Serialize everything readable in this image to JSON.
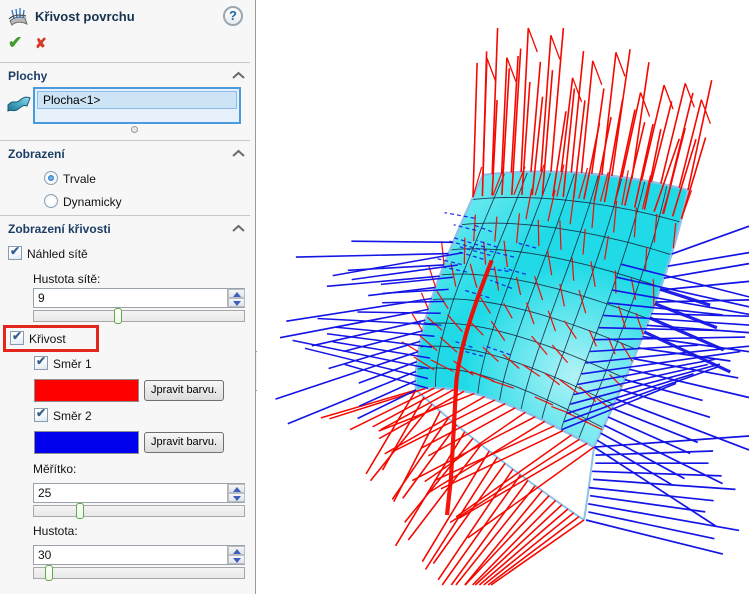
{
  "panel": {
    "title": "Křivost povrchu",
    "help_glyph": "?",
    "ok_glyph": "✔",
    "cancel_glyph": "✘",
    "check_glyph": "✔",
    "sections": {
      "plochy": {
        "label": "Plochy",
        "items": [
          "Plocha<1>"
        ]
      },
      "zobrazeni": {
        "label": "Zobrazení",
        "options": [
          {
            "label": "Trvale",
            "selected": true
          },
          {
            "label": "Dynamicky",
            "selected": false
          }
        ]
      },
      "zobrazeni_krivosti": {
        "label": "Zobrazení křivosti",
        "nahled_site": {
          "label": "Náhled sítě",
          "checked": true
        },
        "hustota_site": {
          "label": "Hustota sítě:",
          "value": "9",
          "slider_pos": 0.4
        },
        "krivost": {
          "label": "Křivost",
          "checked": true,
          "highlight_color": "#e3261d"
        },
        "smer1": {
          "label": "Směr 1",
          "checked": true,
          "color": "#ff0000",
          "button": "Jpravit barvu."
        },
        "smer2": {
          "label": "Směr 2",
          "checked": true,
          "color": "#0000ee",
          "button": "Jpravit barvu."
        },
        "meritko": {
          "label": "Měřítko:",
          "value": "25",
          "slider_pos": 0.22
        },
        "hustota": {
          "label": "Hustota:",
          "value": "30",
          "slider_pos": 0.07
        }
      }
    }
  },
  "viewport": {
    "background": "#ffffff",
    "direction1_color": "#f40800",
    "direction2_color": "#1414e6",
    "surface_color_light": "#9df3f4",
    "surface_color_main": "#20dbe7",
    "surface_edge_color": "#8cc2ec",
    "mesh_color": "#13203a"
  }
}
